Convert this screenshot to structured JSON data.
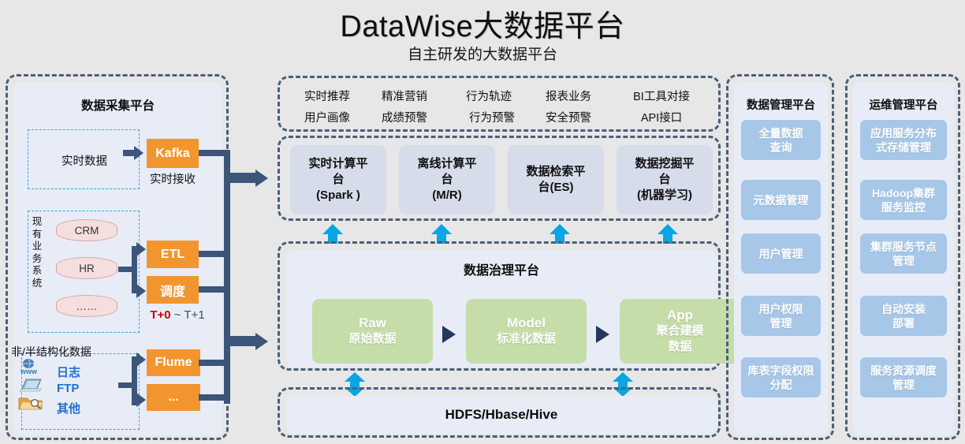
{
  "header": {
    "title": "DataWise大数据平台",
    "subtitle": "自主研发的大数据平台"
  },
  "collect": {
    "title": "数据采集平台",
    "realtime_label": "实时数据",
    "kafka": "Kafka",
    "kafka_caption": "实时接收",
    "biz_vertical_label": "现有业务系统",
    "sources": [
      "CRM",
      "HR",
      "……"
    ],
    "etl": "ETL",
    "scheduler": "调度",
    "tplus_red": "T+0",
    "tplus_rest": " ~ T+1",
    "unstructured_title": "非/半结构化数据",
    "unstructured_items": [
      "日志",
      "FTP",
      "其他"
    ],
    "flume": "Flume",
    "flume_more": "...",
    "icons": [
      "globe-www-icon",
      "laptop-icon",
      "folder-search-icon"
    ]
  },
  "apps": {
    "row1": [
      "实时推荐",
      "精准营销",
      "行为轨迹",
      "报表业务",
      "BI工具对接"
    ],
    "row2": [
      "用户画像",
      "成绩预警",
      "行为预警",
      "安全预警",
      "API接口"
    ]
  },
  "compute": {
    "boxes": [
      "实时计算平\n台\n(Spark )",
      "离线计算平\n台\n(M/R)",
      "数据检索平\n台(ES)",
      "数据挖掘平\n台\n(机器学习)"
    ]
  },
  "governance": {
    "title": "数据治理平台",
    "stages": [
      {
        "name": "Raw",
        "desc": "原始数据"
      },
      {
        "name": "Model",
        "desc": "标准化数据"
      },
      {
        "name": "App",
        "desc": "聚合建模\n数据"
      }
    ]
  },
  "storage": {
    "label": "HDFS/Hbase/Hive"
  },
  "management": {
    "title": "数据管理平台",
    "items": [
      "全量数据\n查询",
      "元数据管理",
      "用户管理",
      "用户权限\n管理",
      "库表字段权限\n分配"
    ]
  },
  "ops": {
    "title": "运维管理平台",
    "items": [
      "应用服务分布\n式存储管理",
      "Hadoop集群\n服务监控",
      "集群服务节点\n管理",
      "自动安装\n部署",
      "服务资源调度\n管理"
    ]
  },
  "colors": {
    "background": "#e7e7e7",
    "orange": "#f2952e",
    "blue_button": "#a7c7e8",
    "green": "#c5dda9",
    "compute_box": "#d6dcea",
    "panel": "#e8ecf7",
    "dash_border": "#4a5f7a",
    "cyan_arrow": "#09a5e4",
    "connector": "#3c5579",
    "cyan_dash": "#2aa8e0",
    "red_text": "#cc0000",
    "link_blue": "#1f6fd0"
  }
}
